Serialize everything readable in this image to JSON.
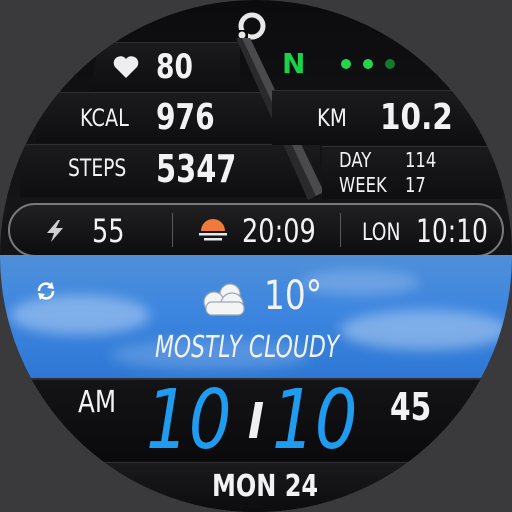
{
  "top_logo": "logo",
  "network_letter": "N",
  "heart_rate": "80",
  "kcal_label": "KCAL",
  "kcal_value": "976",
  "steps_label": "STEPS",
  "steps_value": "5347",
  "km_label": "KM",
  "km_value": "10.2",
  "day_label": "DAY",
  "day_value": "114",
  "week_label": "WEEK",
  "week_value": "17",
  "battery_value": "55",
  "sunset_time": "20:09",
  "lon_label": "LON",
  "lon_time": "10:10",
  "temperature": "10°",
  "condition": "MOSTLY CLOUDY",
  "ampm": "AM",
  "hour": "10",
  "minute": "10",
  "seconds": "45",
  "date": "MON 24",
  "colors": {
    "accent_green": "#19d24a",
    "dot_green_bright": "#24d44c",
    "dot_green_dim": "#167a2e",
    "time_blue": "#1f9cf0",
    "sunset_orange": "#f07a3a"
  },
  "icons": {
    "heart": "heart-icon",
    "battery": "lightning-icon",
    "sunset": "sunset-icon",
    "weather": "cloud-icon",
    "refresh": "refresh-icon"
  }
}
